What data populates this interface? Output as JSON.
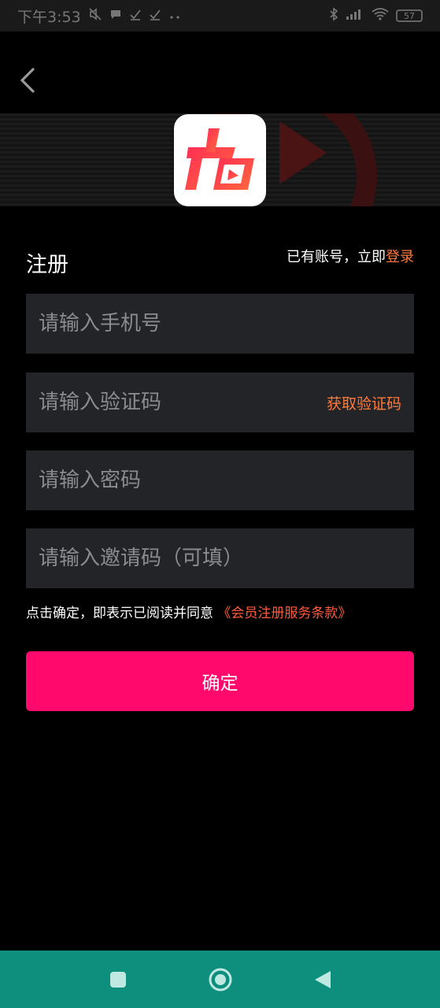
{
  "status_bar": {
    "time": "下午3:53",
    "icons": [
      "mute-icon",
      "message-icon",
      "check-icon",
      "check-icon",
      "more-icon"
    ],
    "right_icons": [
      "bluetooth-icon",
      "signal-icon",
      "wifi-icon"
    ],
    "battery": "57"
  },
  "header": {
    "back_icon": "chevron-left-icon"
  },
  "banner": {
    "logo_icon": "app-logo-icon",
    "accent_color": "#e8344e"
  },
  "register": {
    "title": "注册",
    "login_hint": "已有账号，立即",
    "login_link": "登录"
  },
  "fields": {
    "phone_placeholder": "请输入手机号",
    "code_placeholder": "请输入验证码",
    "get_code_label": "获取验证码",
    "password_placeholder": "请输入密码",
    "invite_placeholder": "请输入邀请码（可填）"
  },
  "terms": {
    "text": "点击确定，即表示已阅读并同意",
    "link": "《会员注册服务条款》"
  },
  "confirm": {
    "label": "确定",
    "color": "#ff0a6c"
  },
  "nav_bar": {
    "color": "#0e8f7e",
    "items": [
      "recent-apps-icon",
      "home-icon",
      "back-icon"
    ]
  }
}
